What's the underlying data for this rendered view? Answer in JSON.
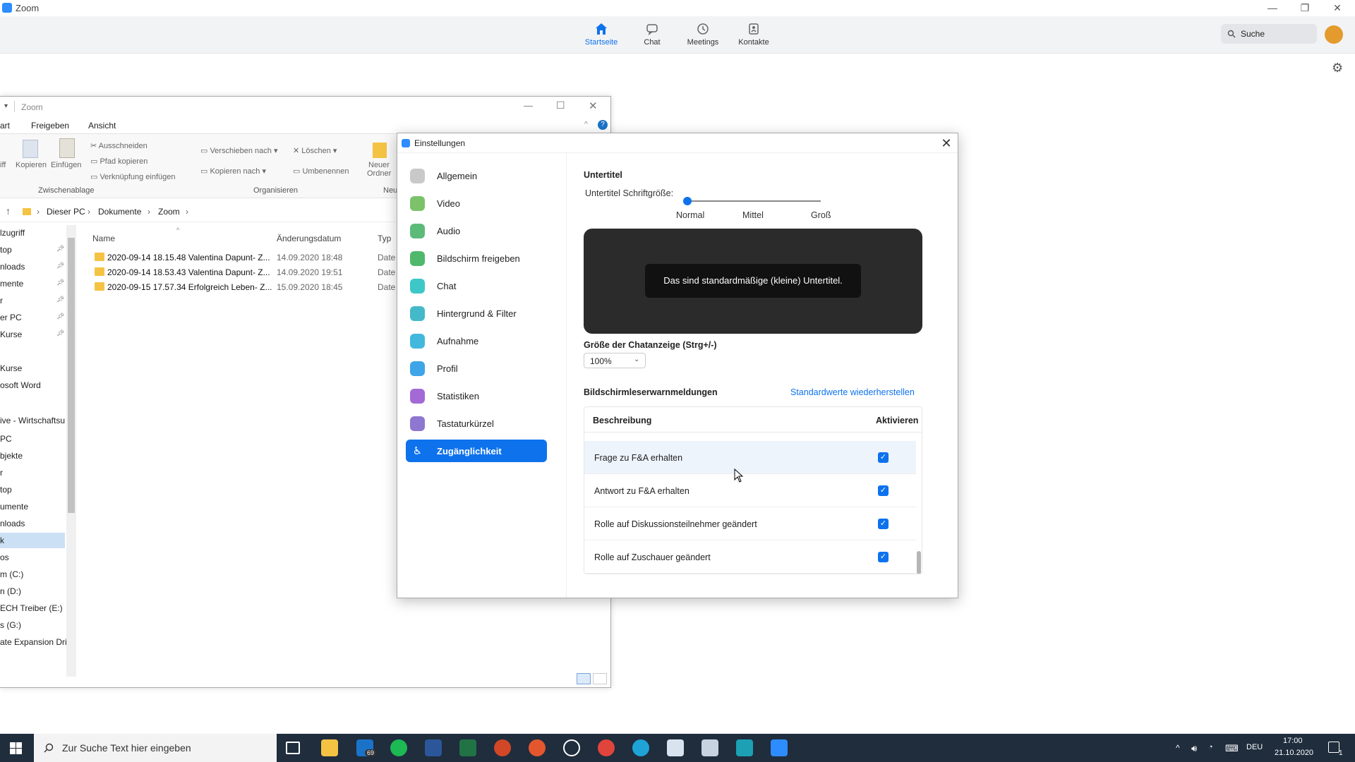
{
  "zoom": {
    "title": "Zoom",
    "nav": [
      {
        "label": "Startseite",
        "icon": "home-icon"
      },
      {
        "label": "Chat",
        "icon": "chat-bubble-icon"
      },
      {
        "label": "Meetings",
        "icon": "clock-icon"
      },
      {
        "label": "Kontakte",
        "icon": "contacts-icon"
      }
    ],
    "search_label": "Suche"
  },
  "explorer": {
    "title": "Zoom",
    "ribbon_tabs": [
      "art",
      "Freigeben",
      "Ansicht"
    ],
    "ribbon": {
      "griff": "iff",
      "kopieren": "Kopieren",
      "einfuegen": "Einfügen",
      "ausschneiden": "Ausschneiden",
      "pfad_kopieren": "Pfad kopieren",
      "verknuepfung": "Verknüpfung einfügen",
      "verschieben": "Verschieben nach",
      "kopieren_nach": "Kopieren nach",
      "loeschen": "Löschen",
      "umbenennen": "Umbenennen",
      "neuer": "Neuer",
      "ordner": "Ordner",
      "group_clipboard": "Zwischenablage",
      "group_organize": "Organisieren",
      "group_new": "Neu"
    },
    "breadcrumb": [
      "Dieser PC",
      "Dokumente",
      "Zoom"
    ],
    "columns": {
      "name": "Name",
      "date": "Änderungsdatum",
      "type": "Typ"
    },
    "files": [
      {
        "name": "2020-09-14 18.15.48 Valentina Dapunt- Z...",
        "date": "14.09.2020 18:48",
        "type": "Date"
      },
      {
        "name": "2020-09-14 18.53.43 Valentina Dapunt- Z...",
        "date": "14.09.2020 19:51",
        "type": "Date"
      },
      {
        "name": "2020-09-15 17.57.34 Erfolgreich Leben- Z...",
        "date": "15.09.2020 18:45",
        "type": "Date"
      }
    ],
    "nav_items": [
      "lzugriff",
      "top",
      "nloads",
      "mente",
      "r",
      "er PC",
      "Kurse",
      "",
      "Kurse",
      "osoft Word",
      "",
      "ive - Wirtschaftsu",
      "PC",
      "bjekte",
      "r",
      "top",
      "umente",
      "nloads",
      "k",
      "os",
      "m (C:)",
      "n (D:)",
      "ECH Treiber (E:)",
      "s (G:)",
      "ate Expansion Dri"
    ]
  },
  "settings": {
    "title": "Einstellungen",
    "sidebar": [
      {
        "label": "Allgemein",
        "color": "#c9c9c9"
      },
      {
        "label": "Video",
        "color": "#7cc26b"
      },
      {
        "label": "Audio",
        "color": "#5dbb7a"
      },
      {
        "label": "Bildschirm freigeben",
        "color": "#4fb86b"
      },
      {
        "label": "Chat",
        "color": "#3ec7c7"
      },
      {
        "label": "Hintergrund & Filter",
        "color": "#44b9c9"
      },
      {
        "label": "Aufnahme",
        "color": "#43b8dd"
      },
      {
        "label": "Profil",
        "color": "#3da5e8"
      },
      {
        "label": "Statistiken",
        "color": "#a36ad6"
      },
      {
        "label": "Tastaturkürzel",
        "color": "#8e77d0"
      },
      {
        "label": "Zugänglichkeit",
        "color": "#ffffff"
      }
    ],
    "untertitel_heading": "Untertitel",
    "font_size_label": "Untertitel Schriftgröße:",
    "slider_options": [
      "Normal",
      "Mittel",
      "Groß"
    ],
    "slider_value": "Normal",
    "caption_preview": "Das sind standardmäßige (kleine) Untertitel.",
    "chat_size_heading": "Größe der Chatanzeige (Strg+/-)",
    "chat_size_value": "100%",
    "alerts_heading": "Bildschirmleserwarnmeldungen",
    "restore_link": "Standardwerte wiederherstellen",
    "table_headers": {
      "desc": "Beschreibung",
      "enable": "Aktivieren"
    },
    "rows": [
      {
        "label": "Frage zu F&A erhalten",
        "checked": true
      },
      {
        "label": "Antwort zu F&A erhalten",
        "checked": true
      },
      {
        "label": "Rolle auf Diskussionsteilnehmer geändert",
        "checked": true
      },
      {
        "label": "Rolle auf Zuschauer geändert",
        "checked": true
      }
    ]
  },
  "taskbar": {
    "search_placeholder": "Zur Suche Text hier eingeben",
    "mail_badge": "69",
    "lang": "DEU",
    "time": "17:00",
    "date": "21.10.2020",
    "notif_count": "1"
  }
}
